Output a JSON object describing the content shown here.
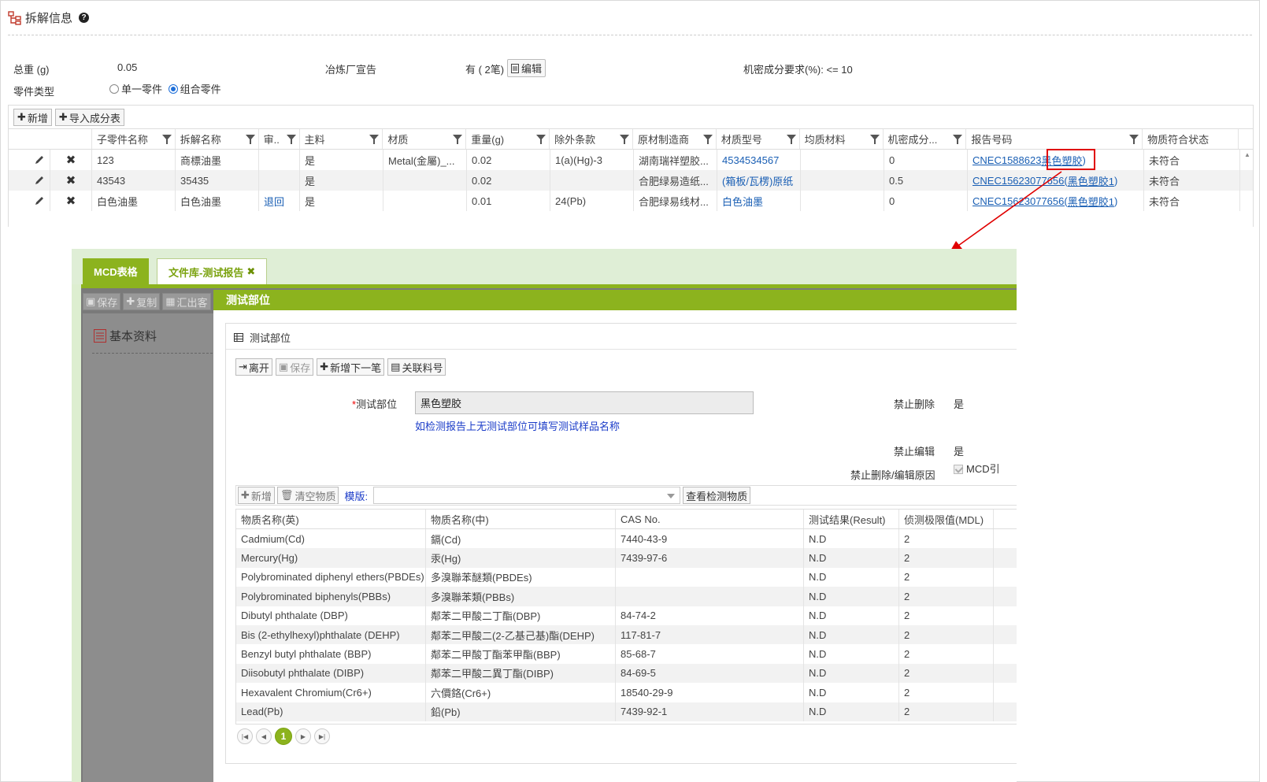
{
  "section": {
    "title": "拆解信息",
    "help": "?"
  },
  "info": {
    "total_weight_label": "总重 (g)",
    "total_weight_value": "0.05",
    "smelter_label": "冶炼厂宣告",
    "smelter_value": "有 ( 2笔)",
    "edit_label": "编辑",
    "confidential_label": "机密成分要求(%):",
    "confidential_value": "<= 10",
    "part_type_label": "零件类型",
    "part_type_options": [
      "单一零件",
      "组合零件"
    ],
    "part_type_selected": "组合零件"
  },
  "toolbar": {
    "add_label": "新增",
    "import_label": "导入成分表"
  },
  "grid": {
    "columns": [
      "子零件名称",
      "拆解名称",
      "审..",
      "主料",
      "材质",
      "重量(g)",
      "除外条款",
      "原材制造商",
      "材质型号",
      "均质材料",
      "机密成分...",
      "报告号码",
      "物质符合状态"
    ],
    "rows": [
      {
        "child": "123",
        "name": "商標油墨",
        "audit": "",
        "main": "是",
        "material": "Metal(金屬)_...",
        "weight": "0.02",
        "exempt": "1(a)(Hg)-3",
        "maker": "湖南瑞祥塑胶...",
        "model": "4534534567",
        "homo": "",
        "conf": "0",
        "report_prefix": "CNEC1588623",
        "report_link": "黑色塑胶",
        "report_suffix": ")",
        "status": "未符合"
      },
      {
        "child": "43543",
        "name": "35435",
        "audit": "",
        "main": "是",
        "material": "",
        "weight": "0.02",
        "exempt": "",
        "maker": "合肥绿易造纸...",
        "model": "(箱板/瓦楞)原纸",
        "homo": "",
        "conf": "0.5",
        "report_prefix": "CNEC15623077656(",
        "report_link": "黑色塑胶1",
        "report_suffix": ")",
        "status": "未符合"
      },
      {
        "child": "白色油墨",
        "name": "白色油墨",
        "audit": "退回",
        "main": "是",
        "material": "",
        "weight": "0.01",
        "exempt": "24(Pb)",
        "maker": "合肥绿易线材...",
        "model": "白色油墨",
        "homo": "",
        "conf": "0",
        "report_prefix": "CNEC15623077656(",
        "report_link": "黑色塑胶1",
        "report_suffix": ")",
        "status": "未符合"
      }
    ]
  },
  "bottom": {
    "tabs": [
      "MCD表格",
      "文件库-测试报告"
    ],
    "close_glyph": "✖",
    "bg_toolbar": [
      "保存",
      "复制",
      "汇出客"
    ],
    "bg_section": "基本资料",
    "dialog": {
      "title": "测试部位",
      "inner_title": "测试部位",
      "buttons": [
        "离开",
        "保存",
        "新增下一笔",
        "关联料号"
      ],
      "field_label": "测试部位",
      "required_mark": "*",
      "field_value": "黑色塑胶",
      "hint": "如检测报告上无测试部位可填写测试样品名称",
      "no_delete_label": "禁止删除",
      "no_delete_value": "是",
      "no_edit_label": "禁止编辑",
      "no_edit_value": "是",
      "reason_label": "禁止删除/编辑原因",
      "reason_value": "MCD引",
      "sub_toolbar": {
        "add": "新增",
        "clear": "清空物质",
        "template_label": "模版:",
        "view": "查看检测物质"
      },
      "sub_columns": [
        "物质名称(英)",
        "物质名称(中)",
        "CAS No.",
        "测试结果(Result)",
        "侦测极限值(MDL)"
      ],
      "sub_rows": [
        [
          "Cadmium(Cd)",
          "鎘(Cd)",
          "7440-43-9",
          "N.D",
          "2"
        ],
        [
          "Mercury(Hg)",
          "汞(Hg)",
          "7439-97-6",
          "N.D",
          "2"
        ],
        [
          "Polybrominated diphenyl ethers(PBDEs)",
          "多溴聯苯醚類(PBDEs)",
          "",
          "N.D",
          "2"
        ],
        [
          "Polybrominated biphenyls(PBBs)",
          "多溴聯苯類(PBBs)",
          "",
          "N.D",
          "2"
        ],
        [
          "Dibutyl phthalate (DBP)",
          "鄰苯二甲酸二丁酯(DBP)",
          "84-74-2",
          "N.D",
          "2"
        ],
        [
          "Bis (2-ethylhexyl)phthalate (DEHP)",
          "鄰苯二甲酸二(2-乙基己基)酯(DEHP)",
          "117-81-7",
          "N.D",
          "2"
        ],
        [
          "Benzyl butyl phthalate (BBP)",
          "鄰苯二甲酸丁酯苯甲酯(BBP)",
          "85-68-7",
          "N.D",
          "2"
        ],
        [
          "Diisobutyl phthalate (DIBP)",
          "鄰苯二甲酸二異丁酯(DIBP)",
          "84-69-5",
          "N.D",
          "2"
        ],
        [
          "Hexavalent Chromium(Cr6+)",
          "六價鉻(Cr6+)",
          "18540-29-9",
          "N.D",
          "2"
        ],
        [
          "Lead(Pb)",
          "鉛(Pb)",
          "7439-92-1",
          "N.D",
          "2"
        ]
      ],
      "pager_current": "1"
    }
  },
  "colors": {
    "accent_green": "#8cb31e",
    "link_blue": "#1a5fb4",
    "highlight_red": "#e00000"
  }
}
